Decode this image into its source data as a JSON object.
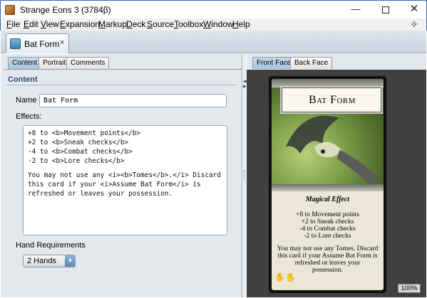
{
  "window": {
    "title": "Strange Eons 3 (3784β)",
    "minimize_glyph": "—",
    "close_glyph": "✕"
  },
  "menu": [
    "File",
    "Edit",
    "View",
    "Expansion",
    "Markup",
    "Deck",
    "Source",
    "Toolbox",
    "Window",
    "Help"
  ],
  "document_tab": {
    "label": "Bat Form",
    "close_glyph": "×"
  },
  "editor": {
    "tabs": [
      "Content",
      "Portrait",
      "Comments"
    ],
    "active_tab": "Content",
    "section_title": "Content",
    "name_label": "Name",
    "name_value": "Bat Form",
    "effects_label": "Effects:",
    "effects_lines": [
      "+8 to <b>Movement points</b>",
      "+2 to <b>Sneak checks</b>",
      "-4 to <b>Combat checks</b>",
      "-2 to <b>Lore checks</b>",
      "",
      "You may not use any <i><b>Tomes</b>.</i> Discard",
      "this card if your <i>Assume Bat Form</i> is",
      "refreshed or leaves your possession."
    ],
    "hand_label": "Hand Requirements",
    "hand_value": "2 Hands"
  },
  "preview": {
    "tabs": [
      "Front Face",
      "Back Face"
    ],
    "active_tab": "Front Face",
    "zoom": "100%"
  },
  "card": {
    "title": "Bat Form",
    "type": "Magical Effect",
    "stat_lines": [
      "+8 to Movement points",
      "+2 to Sneak checks",
      "-4 to Combat checks",
      "-2 to Lore checks"
    ],
    "rule_lines": [
      "You may not use any Tomes. Discard",
      "this card if your Assume Bat Form is",
      "refreshed or leaves your",
      "possession."
    ],
    "hands_glyph": "✋✋"
  },
  "colors": {
    "accent": "#2d6fb4",
    "section_title": "#2a4e7a",
    "viewer_bg": "#404040"
  }
}
